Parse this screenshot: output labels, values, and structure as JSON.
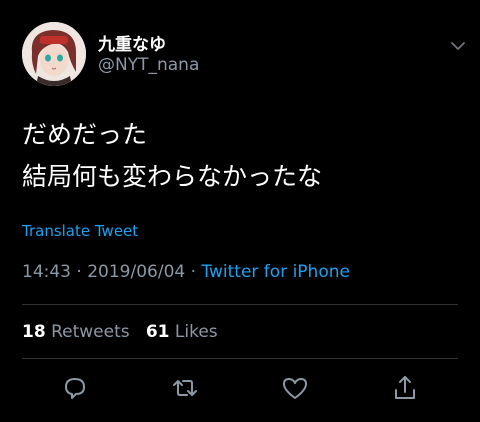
{
  "user": {
    "display_name": "九重なゆ",
    "handle": "@NYT_nana"
  },
  "tweet": {
    "text": "だめだった\n結局何も変わらなかったな",
    "translate_label": "Translate Tweet",
    "time": "14:43",
    "date": "2019/06/04",
    "separator": "·",
    "source": "Twitter for iPhone"
  },
  "stats": {
    "retweets_count": "18",
    "retweets_label": "Retweets",
    "likes_count": "61",
    "likes_label": "Likes"
  },
  "icons": {
    "menu": "chevron-down-icon",
    "reply": "reply-icon",
    "retweet": "retweet-icon",
    "like": "heart-icon",
    "share": "share-icon"
  },
  "colors": {
    "background": "#000000",
    "accent": "#1da1f2",
    "secondary_text": "#8b98a5",
    "divider": "#2f3336"
  }
}
